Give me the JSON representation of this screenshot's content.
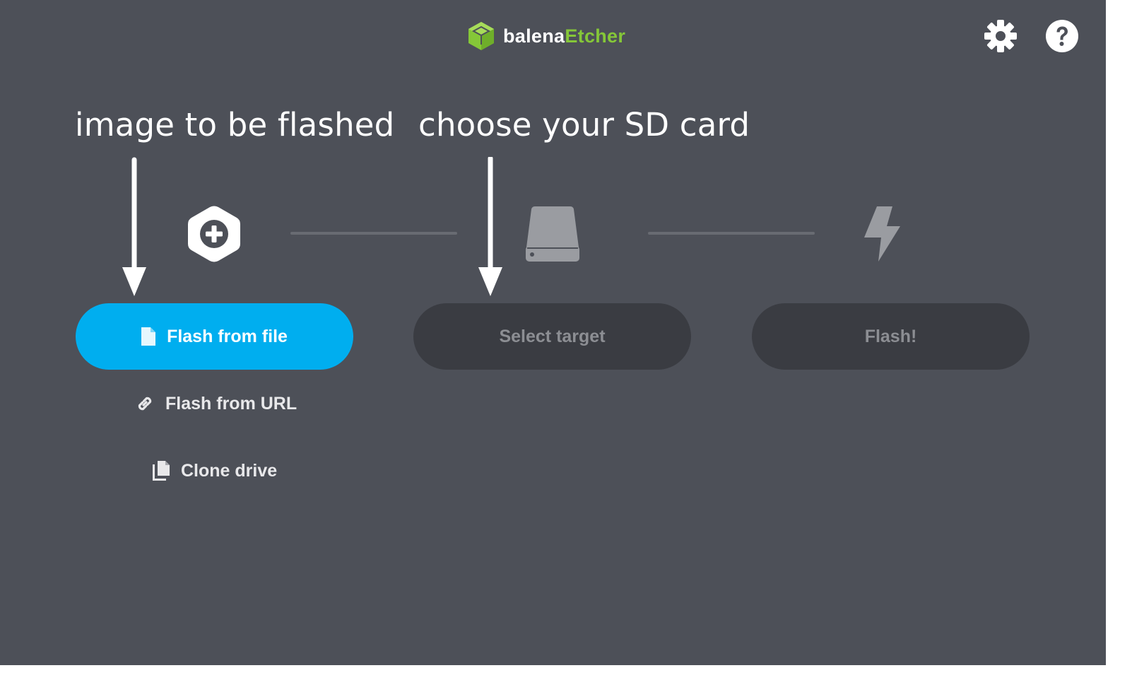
{
  "header": {
    "brand_prefix": "balena",
    "brand_suffix": "Etcher",
    "settings_icon": "gear-icon",
    "help_icon": "question-circle-icon"
  },
  "annotations": {
    "image_label": "image to be flashed",
    "target_label": "choose your SD card"
  },
  "steps": {
    "image": {
      "icon": "hexagon-plus-icon",
      "button_label": "Flash from file",
      "button_icon": "file-icon"
    },
    "target": {
      "icon": "drive-icon",
      "button_label": "Select target"
    },
    "flash": {
      "icon": "lightning-icon",
      "button_label": "Flash!"
    }
  },
  "secondary_actions": {
    "url_label": "Flash from URL",
    "url_icon": "link-icon",
    "clone_label": "Clone drive",
    "clone_icon": "copy-icon"
  },
  "colors": {
    "background": "#4d5058",
    "primary_button": "#00aeef",
    "disabled_button": "#3a3c42",
    "brand_green": "#85c738"
  }
}
